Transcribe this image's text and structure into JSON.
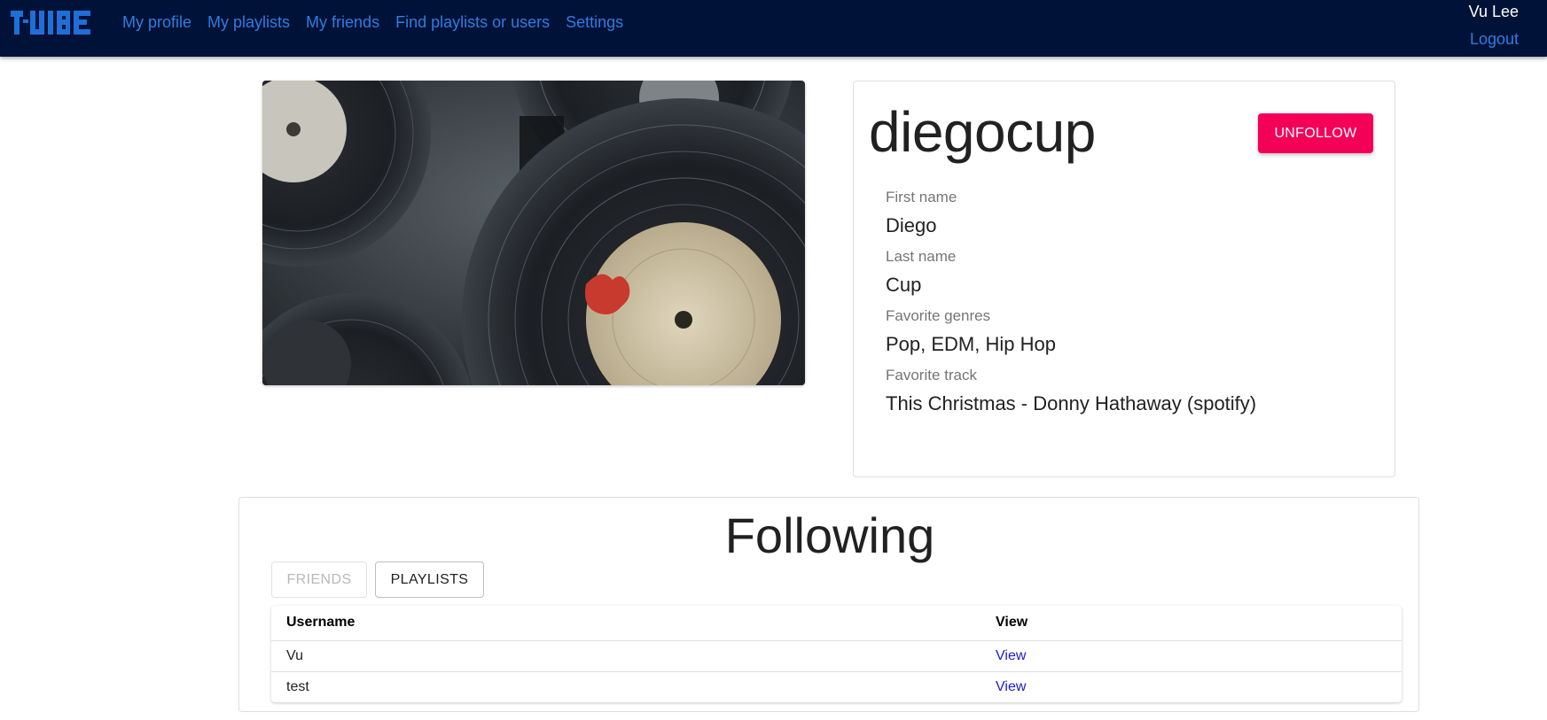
{
  "nav": {
    "logo_text": "T-VIBE",
    "links": [
      "My profile",
      "My playlists",
      "My friends",
      "Find playlists or users",
      "Settings"
    ],
    "user_name": "Vu Lee",
    "logout_label": "Logout"
  },
  "profile": {
    "username": "diegocup",
    "unfollow_label": "UNFOLLOW",
    "fields": [
      {
        "label": "First name",
        "value": "Diego"
      },
      {
        "label": "Last name",
        "value": "Cup"
      },
      {
        "label": "Favorite genres",
        "value": "Pop, EDM, Hip Hop"
      },
      {
        "label": "Favorite track",
        "value": "This Christmas - Donny Hathaway (spotify)"
      }
    ],
    "image_icon": "vinyl-records-photo"
  },
  "following": {
    "title": "Following",
    "tabs": {
      "friends": "FRIENDS",
      "playlists": "PLAYLISTS"
    },
    "columns": {
      "username": "Username",
      "view": "View"
    },
    "rows": [
      {
        "username": "Vu",
        "view": "View"
      },
      {
        "username": "test",
        "view": "View"
      }
    ]
  },
  "colors": {
    "nav_bg": "#001238",
    "link": "#2e7de0",
    "accent": "#f50057",
    "view_link": "#1a1ad6"
  }
}
